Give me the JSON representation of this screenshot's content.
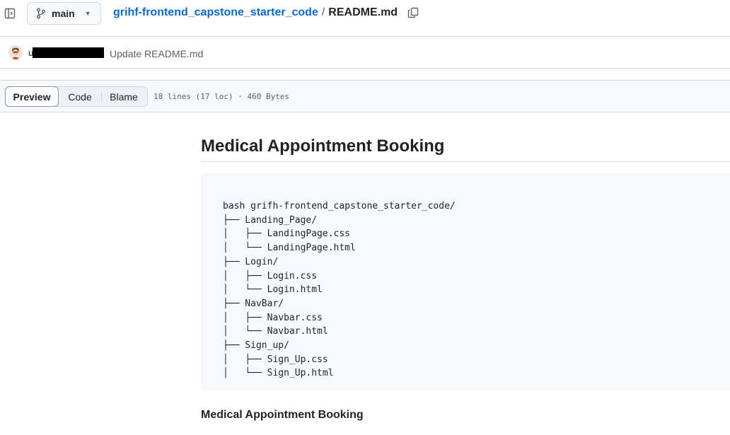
{
  "header": {
    "branch_label": "main",
    "repo_name": "grihf-frontend_capstone_starter_code",
    "separator": "/",
    "file_name": "README.md"
  },
  "commit": {
    "author_visible": "u",
    "message": "Update README.md"
  },
  "file_toolbar": {
    "tabs": [
      "Preview",
      "Code",
      "Blame"
    ],
    "active_tab": "Preview",
    "info": "18 lines (17 loc) · 460 Bytes"
  },
  "readme": {
    "title": "Medical Appointment Booking",
    "code_lines": [
      "bash grifh-frontend_capstone_starter_code/",
      "├── Landing_Page/",
      "│   ├── LandingPage.css",
      "│   └── LandingPage.html",
      "├── Login/",
      "│   ├── Login.css",
      "│   └── Login.html",
      "├── NavBar/",
      "│   ├── Navbar.css",
      "│   └── Navbar.html",
      "├── Sign_up/",
      "│   ├── Sign_Up.css",
      "│   └── Sign_Up.html"
    ],
    "subheading": "Medical Appointment Booking"
  },
  "colors": {
    "link": "#0969da",
    "muted": "#59636e",
    "border": "#d1d9e0",
    "code_bg": "#f6f8fa"
  },
  "icons": {
    "panel_toggle": "sidebar-expand-icon",
    "branch": "git-branch-icon",
    "caret": "triangle-down-icon",
    "copy": "copy-icon"
  }
}
